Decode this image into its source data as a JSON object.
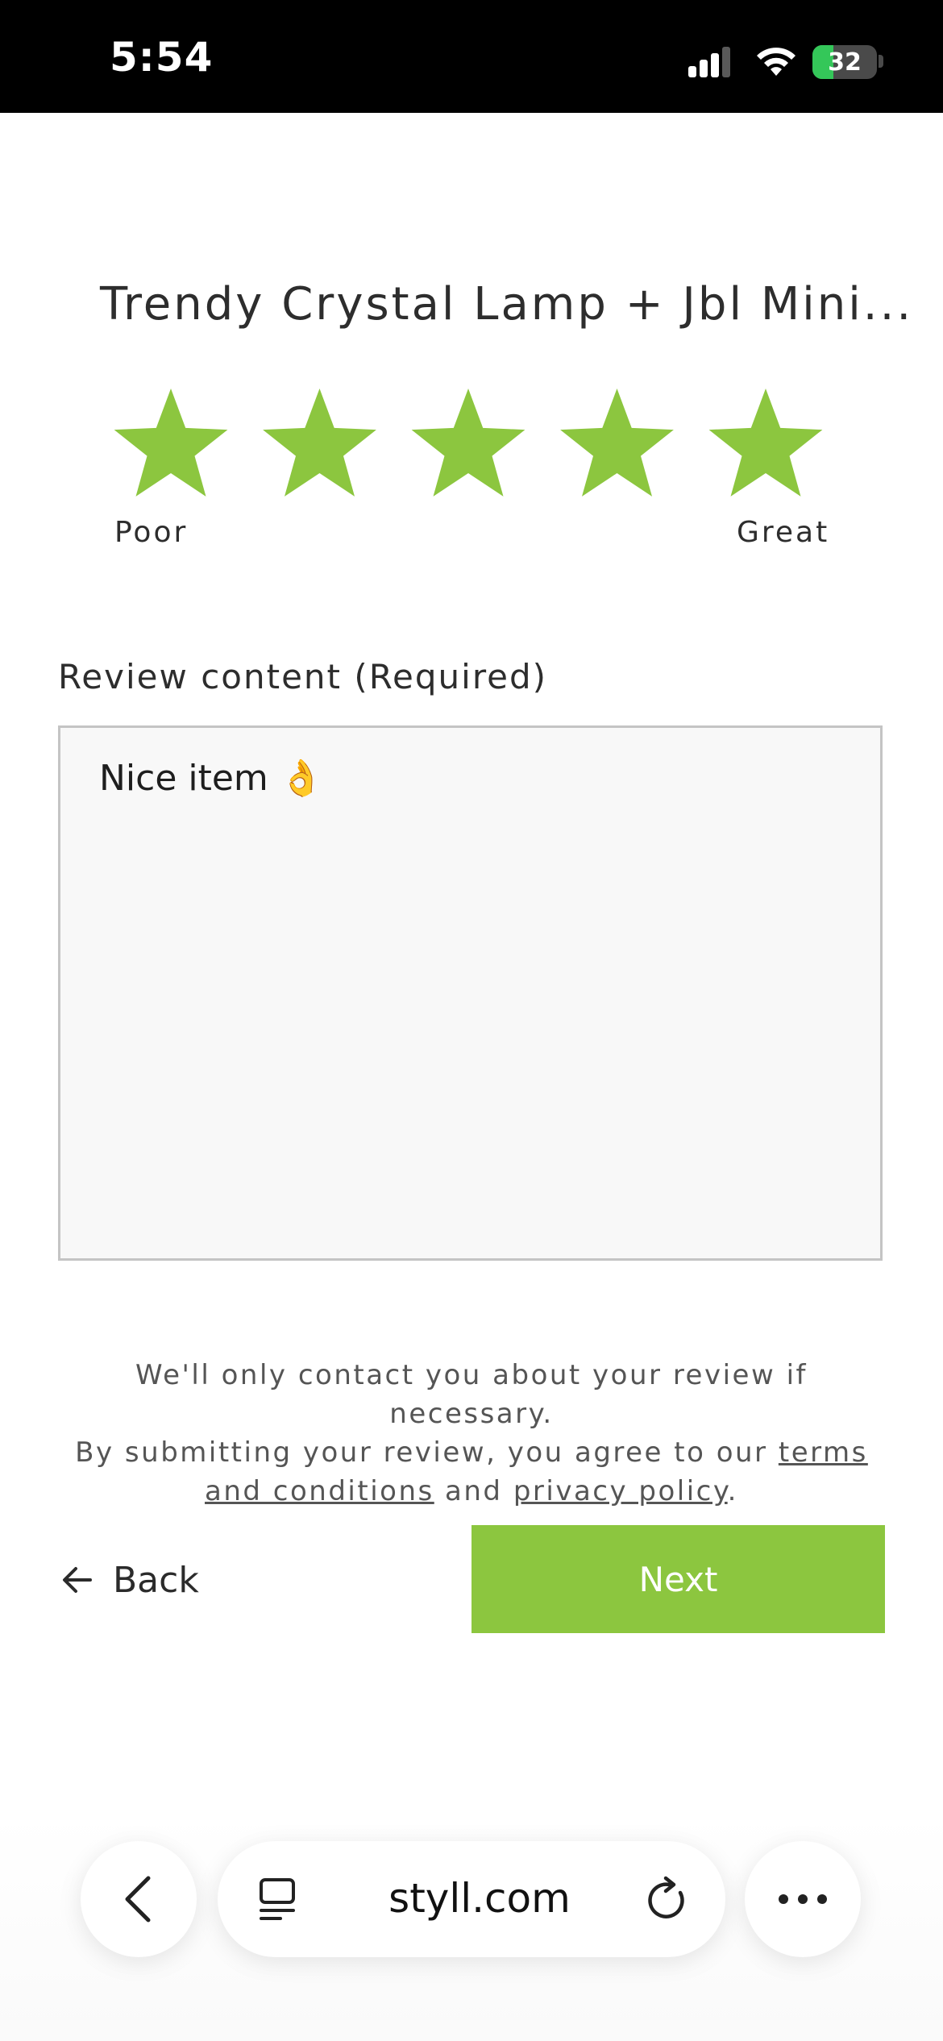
{
  "status_bar": {
    "time": "5:54",
    "battery_percent": "32",
    "signal_icon": "cellular-signal-icon",
    "wifi_icon": "wifi-icon",
    "battery_icon": "battery-charging-icon"
  },
  "product": {
    "title": "Trendy Crystal Lamp + Jbl Mini..."
  },
  "rating": {
    "selected": 5,
    "max": 5,
    "low_label": "Poor",
    "high_label": "Great",
    "star_color": "#8cc63f",
    "star_icon": "star-icon"
  },
  "review": {
    "label": "Review content (Required)",
    "value": "Nice item 👌"
  },
  "disclaimer": {
    "line1": "We'll only contact you about your review if necessary.",
    "line2_prefix": "By submitting your review, you agree to our ",
    "terms_link": "terms and conditions",
    "joiner": " and ",
    "privacy_link": "privacy policy",
    "suffix": "."
  },
  "actions": {
    "back_label": "Back",
    "back_icon": "arrow-left-icon",
    "next_label": "Next",
    "accent_color": "#8cc63f"
  },
  "browser": {
    "url": "styll.com",
    "back_icon": "chevron-left-icon",
    "tabs_icon": "page-menu-icon",
    "reload_icon": "reload-icon",
    "more_icon": "more-icon"
  }
}
